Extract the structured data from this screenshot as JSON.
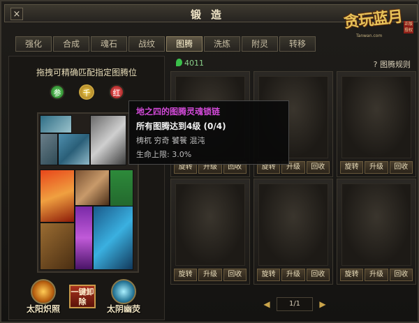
{
  "window": {
    "title": "锻造",
    "close_glyph": "×"
  },
  "logo": {
    "main": "贪玩蓝月",
    "sub": "Tanwan.com",
    "stamp": "正版授权"
  },
  "tabs": [
    "强化",
    "合成",
    "魂石",
    "战纹",
    "图腾",
    "洗炼",
    "附灵",
    "转移"
  ],
  "active_tab": "图腾",
  "left": {
    "instruction": "拖拽可精确匹配指定图腾位",
    "gems": [
      "参",
      "千",
      "红"
    ],
    "skills": {
      "sun": "太阳炽照",
      "moon": "太阴幽荧"
    },
    "remove_button": "一键卸除"
  },
  "right": {
    "energy": "4011",
    "rules": "? 图腾规则",
    "slot_buttons": [
      "旋转",
      "升级",
      "回收"
    ],
    "page": "1/1",
    "prev_glyph": "◀",
    "next_glyph": "▶"
  },
  "tooltip": {
    "title": "地之四的图腾灵魂锁链",
    "requirement": "所有图腾达到4级 (0/4)",
    "names": "梼杌 穷奇 饕餮 混沌",
    "bonus": "生命上限:  3.0%"
  }
}
